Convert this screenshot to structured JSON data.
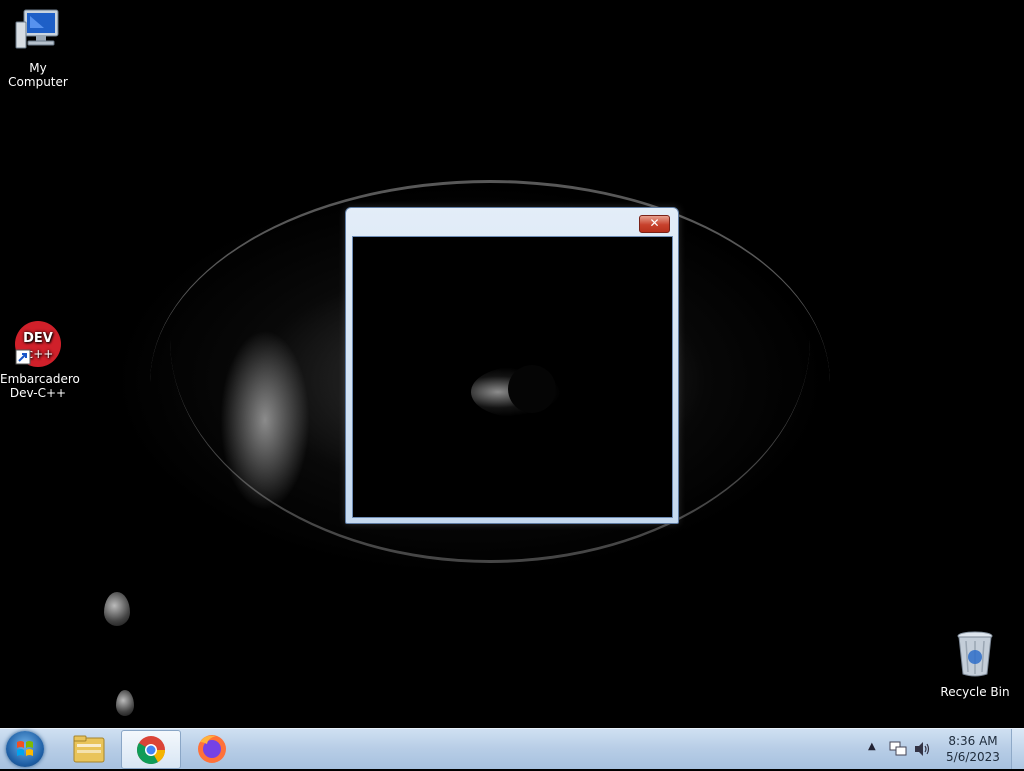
{
  "desktop": {
    "icons": [
      {
        "label": "My Computer"
      },
      {
        "label": "Embarcadero Dev-C++"
      },
      {
        "label": "Recycle Bin"
      }
    ],
    "devcpp_logo_text": "DEV"
  },
  "window": {
    "close_glyph": "✕"
  },
  "taskbar": {
    "items": [
      "start-orb",
      "file-explorer",
      "google-chrome",
      "firefox"
    ],
    "active_item": "google-chrome",
    "clock_time": "8:36 AM",
    "clock_date": "5/6/2023"
  },
  "colors": {
    "taskbar": "#b7cde6",
    "window_frame": "#c5d9ef",
    "close_button": "#c7412c"
  }
}
